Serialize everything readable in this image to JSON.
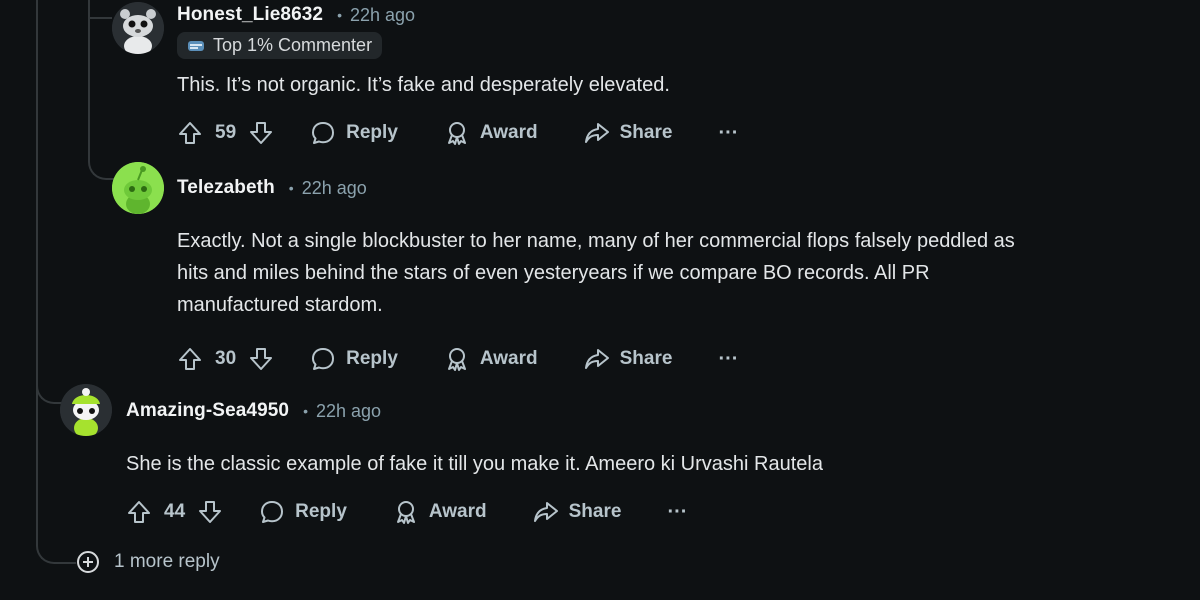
{
  "comments": [
    {
      "author": "Honest_Lie8632",
      "time": "22h ago",
      "flair": "Top 1% Commenter",
      "body": "This. It’s not organic. It’s fake and desperately elevated.",
      "score": "59",
      "reply_label": "Reply",
      "award_label": "Award",
      "share_label": "Share",
      "more_label": "···"
    },
    {
      "author": "Telezabeth",
      "time": "22h ago",
      "body_lines": [
        "Exactly. Not a single blockbuster to her name, many of her commercial flops falsely peddled as",
        "hits and miles behind the stars of even yesteryears if we compare BO records. All PR",
        "manufactured stardom."
      ],
      "score": "30",
      "reply_label": "Reply",
      "award_label": "Award",
      "share_label": "Share",
      "more_label": "···"
    },
    {
      "author": "Amazing-Sea4950",
      "time": "22h ago",
      "body": "She is the classic example of fake it till you make it. Ameero ki Urvashi Rautela",
      "score": "44",
      "reply_label": "Reply",
      "award_label": "Award",
      "share_label": "Share",
      "more_label": "···"
    }
  ],
  "more_replies": "1 more reply",
  "colors": {
    "background": "#0e1113",
    "thread_line": "#33383b",
    "avatar_green": "#8be04e",
    "avatar_dark": "#2a2f33"
  }
}
